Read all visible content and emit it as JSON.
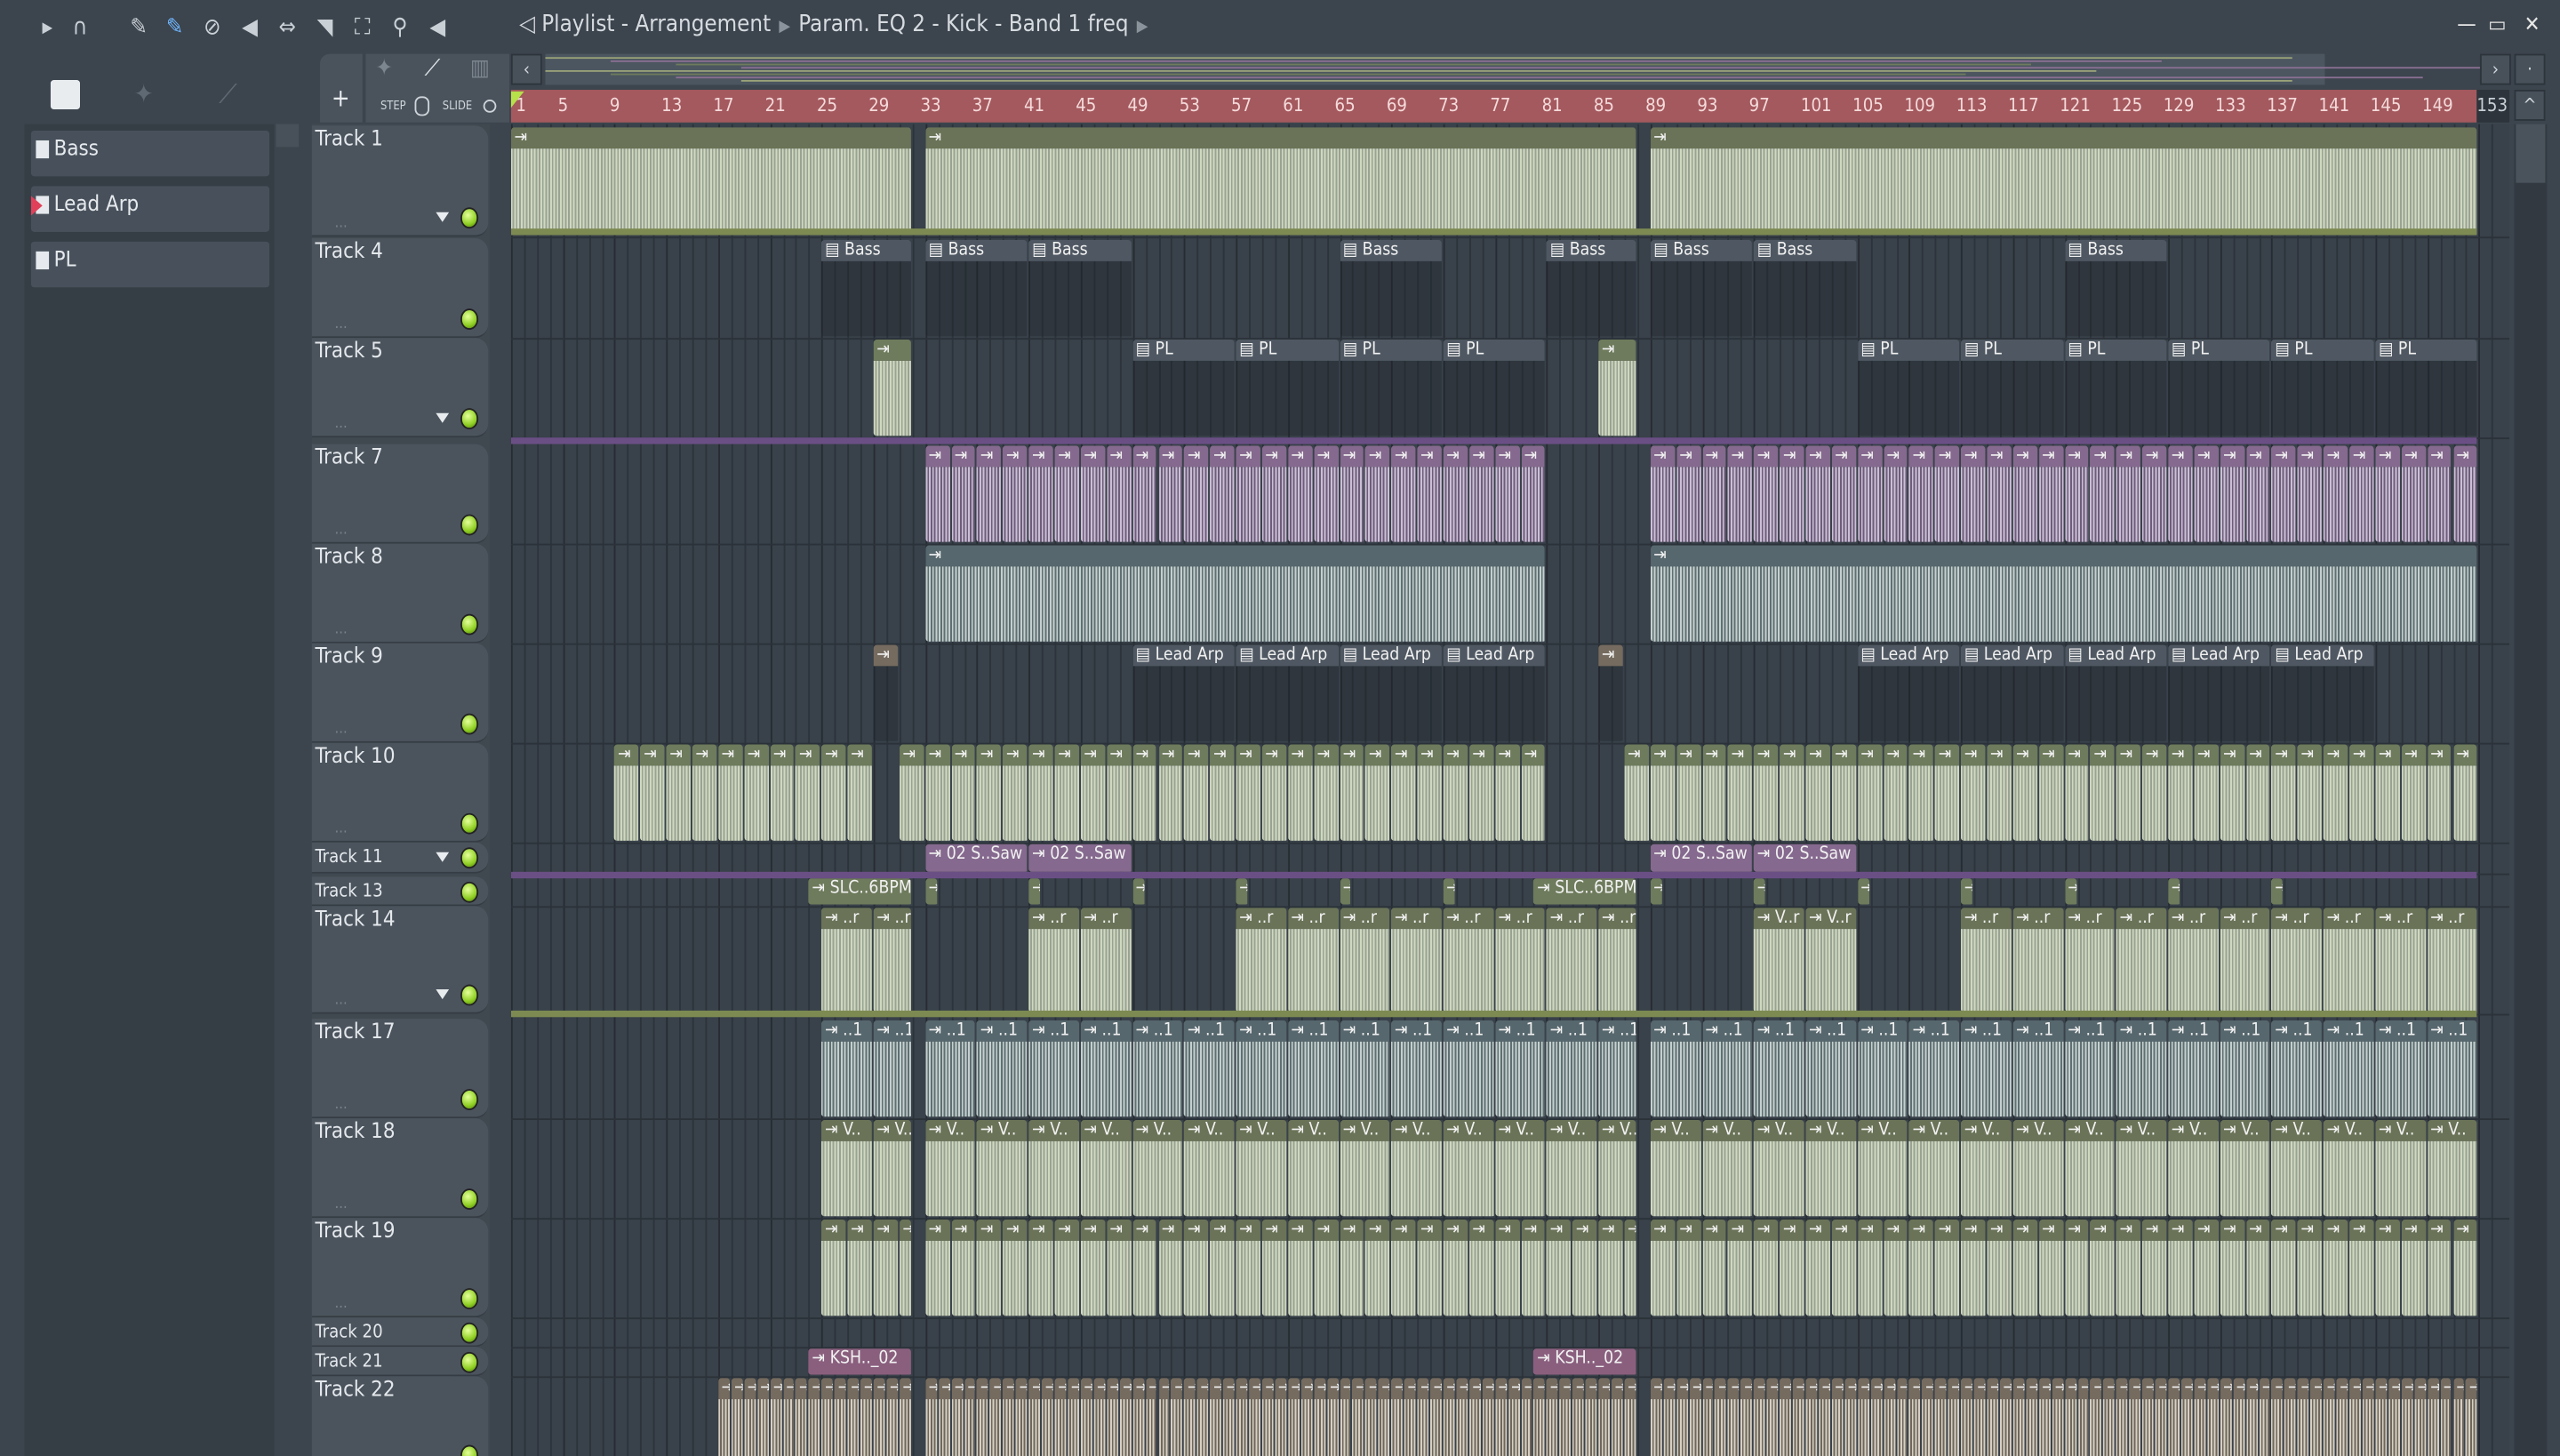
{
  "toolbar": {
    "icons": [
      "play-icon",
      "magnet-icon",
      "pencil-icon",
      "paint-icon",
      "delete-icon",
      "mute-icon",
      "slip-icon",
      "slice-icon",
      "select-icon",
      "zoom-icon",
      "playback-icon"
    ],
    "title_parts": [
      "Playlist - Arrangement",
      "Param. EQ 2 - Kick - Band 1 freq"
    ]
  },
  "window": {
    "minimize": "—",
    "maximize": "▭",
    "close": "✕"
  },
  "panel": {
    "step_label": "STEP",
    "slide_label": "SLIDE",
    "add": "+"
  },
  "browser": {
    "items": [
      {
        "label": "Bass"
      },
      {
        "label": "Lead Arp"
      },
      {
        "label": "PL"
      }
    ]
  },
  "ruler": {
    "ticks": [
      "1",
      "5",
      "9",
      "13",
      "17",
      "21",
      "25",
      "29",
      "33",
      "37",
      "41",
      "45",
      "49",
      "53",
      "57",
      "61",
      "65",
      "69",
      "73",
      "77",
      "81",
      "85",
      "89",
      "93",
      "97",
      "101",
      "105",
      "109",
      "113",
      "117",
      "121",
      "125",
      "129",
      "133",
      "137",
      "141",
      "145",
      "149"
    ],
    "end": "153"
  },
  "colors": {
    "ruler": "#a4595e",
    "green": "#6e7b5c",
    "purple": "#85698e",
    "gray": "#4f5862",
    "pink": "#8a5f7e",
    "brown": "#756b5e",
    "olive": "#6a7357",
    "teal": "#56676d"
  },
  "tracks": [
    {
      "name": "Track 1",
      "clips": [
        {
          "s": 1,
          "e": 32,
          "step": 31,
          "label": "",
          "c": "olive",
          "w": "wave"
        },
        {
          "s": 33,
          "e": 88,
          "step": 55,
          "label": "",
          "c": "olive",
          "w": "wave"
        },
        {
          "s": 89,
          "e": 153,
          "step": 64,
          "label": "",
          "c": "olive",
          "w": "wave"
        }
      ]
    },
    {
      "name": "Track 4",
      "clips": [
        {
          "s": 25,
          "e": 32,
          "step": 7,
          "label": "Bass",
          "c": "gray"
        },
        {
          "s": 33,
          "e": 41,
          "step": 8,
          "label": "Bass",
          "c": "gray"
        },
        {
          "s": 41,
          "e": 49,
          "step": 8,
          "label": "Bass",
          "c": "gray"
        },
        {
          "s": 65,
          "e": 73,
          "step": 8,
          "label": "Bass",
          "c": "gray"
        },
        {
          "s": 81,
          "e": 88,
          "step": 7,
          "label": "Bass",
          "c": "gray"
        },
        {
          "s": 89,
          "e": 97,
          "step": 8,
          "label": "Bass",
          "c": "gray"
        },
        {
          "s": 97,
          "e": 105,
          "step": 8,
          "label": "Bass",
          "c": "gray"
        },
        {
          "s": 121,
          "e": 129,
          "step": 8,
          "label": "Bass",
          "c": "gray"
        }
      ]
    },
    {
      "name": "Track 5",
      "clips": [
        {
          "s": 29,
          "e": 32,
          "step": 3,
          "label": "",
          "c": "green",
          "w": "wave"
        },
        {
          "s": 85,
          "e": 88,
          "step": 3,
          "label": "",
          "c": "green",
          "w": "wave"
        },
        {
          "s": 49,
          "e": 81,
          "step": 8,
          "label": "PL",
          "c": "gray"
        },
        {
          "s": 105,
          "e": 153,
          "step": 8,
          "label": "PL",
          "c": "gray"
        }
      ]
    },
    {
      "name": "Track 7",
      "clips": [
        {
          "s": 33,
          "e": 81,
          "step": 2,
          "label": "",
          "c": "purple",
          "w": "wave"
        },
        {
          "s": 89,
          "e": 153,
          "step": 2,
          "label": "",
          "c": "purple",
          "w": "wave"
        }
      ]
    },
    {
      "name": "Track 8",
      "clips": [
        {
          "s": 33,
          "e": 81,
          "step": 48,
          "label": "",
          "c": "teal",
          "w": "wave"
        },
        {
          "s": 89,
          "e": 153,
          "step": 64,
          "label": "",
          "c": "teal",
          "w": "wave"
        }
      ]
    },
    {
      "name": "Track 9",
      "clips": [
        {
          "s": 29,
          "e": 31,
          "step": 2,
          "label": "",
          "c": "brown"
        },
        {
          "s": 85,
          "e": 87,
          "step": 2,
          "label": "",
          "c": "brown"
        },
        {
          "s": 49,
          "e": 81,
          "step": 8,
          "label": "Lead Arp",
          "c": "gray"
        },
        {
          "s": 105,
          "e": 145,
          "step": 8,
          "label": "Lead Arp",
          "c": "gray"
        }
      ]
    },
    {
      "name": "Track 10",
      "clips": [
        {
          "s": 9,
          "e": 29,
          "step": 2,
          "label": "",
          "c": "green",
          "w": "wave"
        },
        {
          "s": 31,
          "e": 81,
          "step": 2,
          "label": "",
          "c": "green",
          "w": "wave"
        },
        {
          "s": 87,
          "e": 153,
          "step": 2,
          "label": "",
          "c": "green",
          "w": "wave"
        }
      ]
    },
    {
      "name": "Track 11",
      "clips": [
        {
          "s": 33,
          "e": 49,
          "step": 8,
          "label": "02 S..Saw",
          "c": "purple"
        },
        {
          "s": 89,
          "e": 105,
          "step": 8,
          "label": "02 S..Saw",
          "c": "purple"
        }
      ]
    },
    {
      "name": "Track 13",
      "clips": [
        {
          "s": 24,
          "e": 32,
          "step": 8,
          "label": "SLC..6BPM",
          "c": "green"
        },
        {
          "s": 33,
          "e": 34,
          "step": 1,
          "label": "",
          "c": "green"
        },
        {
          "s": 41,
          "e": 42,
          "step": 1,
          "label": "",
          "c": "green"
        },
        {
          "s": 49,
          "e": 50,
          "step": 1,
          "label": "",
          "c": "green"
        },
        {
          "s": 57,
          "e": 58,
          "step": 1,
          "label": "",
          "c": "green"
        },
        {
          "s": 65,
          "e": 66,
          "step": 1,
          "label": "",
          "c": "green"
        },
        {
          "s": 73,
          "e": 74,
          "step": 1,
          "label": "",
          "c": "green"
        },
        {
          "s": 80,
          "e": 88,
          "step": 8,
          "label": "SLC..6BPM",
          "c": "green"
        },
        {
          "s": 89,
          "e": 90,
          "step": 1,
          "label": "",
          "c": "green"
        },
        {
          "s": 97,
          "e": 98,
          "step": 1,
          "label": "",
          "c": "green"
        },
        {
          "s": 105,
          "e": 106,
          "step": 1,
          "label": "",
          "c": "green"
        },
        {
          "s": 113,
          "e": 114,
          "step": 1,
          "label": "",
          "c": "green"
        },
        {
          "s": 121,
          "e": 122,
          "step": 1,
          "label": "",
          "c": "green"
        },
        {
          "s": 129,
          "e": 130,
          "step": 1,
          "label": "",
          "c": "green"
        },
        {
          "s": 137,
          "e": 138,
          "step": 1,
          "label": "",
          "c": "green"
        }
      ]
    },
    {
      "name": "Track 14",
      "clips": [
        {
          "s": 25,
          "e": 32,
          "step": 4,
          "label": "..r",
          "c": "olive",
          "w": "wave"
        },
        {
          "s": 41,
          "e": 49,
          "step": 4,
          "label": "..r",
          "c": "olive",
          "w": "wave"
        },
        {
          "s": 57,
          "e": 88,
          "step": 4,
          "label": "..r",
          "c": "olive",
          "w": "wave"
        },
        {
          "s": 97,
          "e": 105,
          "step": 4,
          "label": "V..r",
          "c": "olive",
          "w": "wave"
        },
        {
          "s": 113,
          "e": 153,
          "step": 4,
          "label": "..r",
          "c": "olive",
          "w": "wave"
        }
      ]
    },
    {
      "name": "Track 17",
      "clips": [
        {
          "s": 25,
          "e": 32,
          "step": 4,
          "label": "..1",
          "c": "teal",
          "w": "wave"
        },
        {
          "s": 33,
          "e": 88,
          "step": 4,
          "label": "..1",
          "c": "teal",
          "w": "wave"
        },
        {
          "s": 89,
          "e": 153,
          "step": 4,
          "label": "..1",
          "c": "teal",
          "w": "wave"
        }
      ]
    },
    {
      "name": "Track 18",
      "clips": [
        {
          "s": 25,
          "e": 32,
          "step": 4,
          "label": "V..",
          "c": "olive",
          "w": "wave"
        },
        {
          "s": 33,
          "e": 88,
          "step": 4,
          "label": "V..",
          "c": "olive",
          "w": "wave"
        },
        {
          "s": 89,
          "e": 153,
          "step": 4,
          "label": "V..",
          "c": "olive",
          "w": "wave"
        }
      ]
    },
    {
      "name": "Track 19",
      "clips": [
        {
          "s": 25,
          "e": 32,
          "step": 2,
          "label": "",
          "c": "olive",
          "w": "wave"
        },
        {
          "s": 33,
          "e": 88,
          "step": 2,
          "label": "",
          "c": "olive",
          "w": "wave"
        },
        {
          "s": 89,
          "e": 153,
          "step": 2,
          "label": "",
          "c": "olive",
          "w": "wave"
        }
      ]
    },
    {
      "name": "Track 20",
      "clips": []
    },
    {
      "name": "Track 21",
      "clips": [
        {
          "s": 24,
          "e": 32,
          "step": 8,
          "label": "KSH.._02",
          "c": "pink"
        },
        {
          "s": 80,
          "e": 88,
          "step": 8,
          "label": "KSH.._02",
          "c": "pink"
        }
      ]
    },
    {
      "name": "Track 22",
      "clips": [
        {
          "s": 17,
          "e": 32,
          "step": 1,
          "label": "",
          "c": "brown",
          "w": "wave"
        },
        {
          "s": 33,
          "e": 88,
          "step": 1,
          "label": "",
          "c": "brown",
          "w": "wave"
        },
        {
          "s": 89,
          "e": 153,
          "step": 1,
          "label": "",
          "c": "brown",
          "w": "wave"
        }
      ]
    }
  ]
}
